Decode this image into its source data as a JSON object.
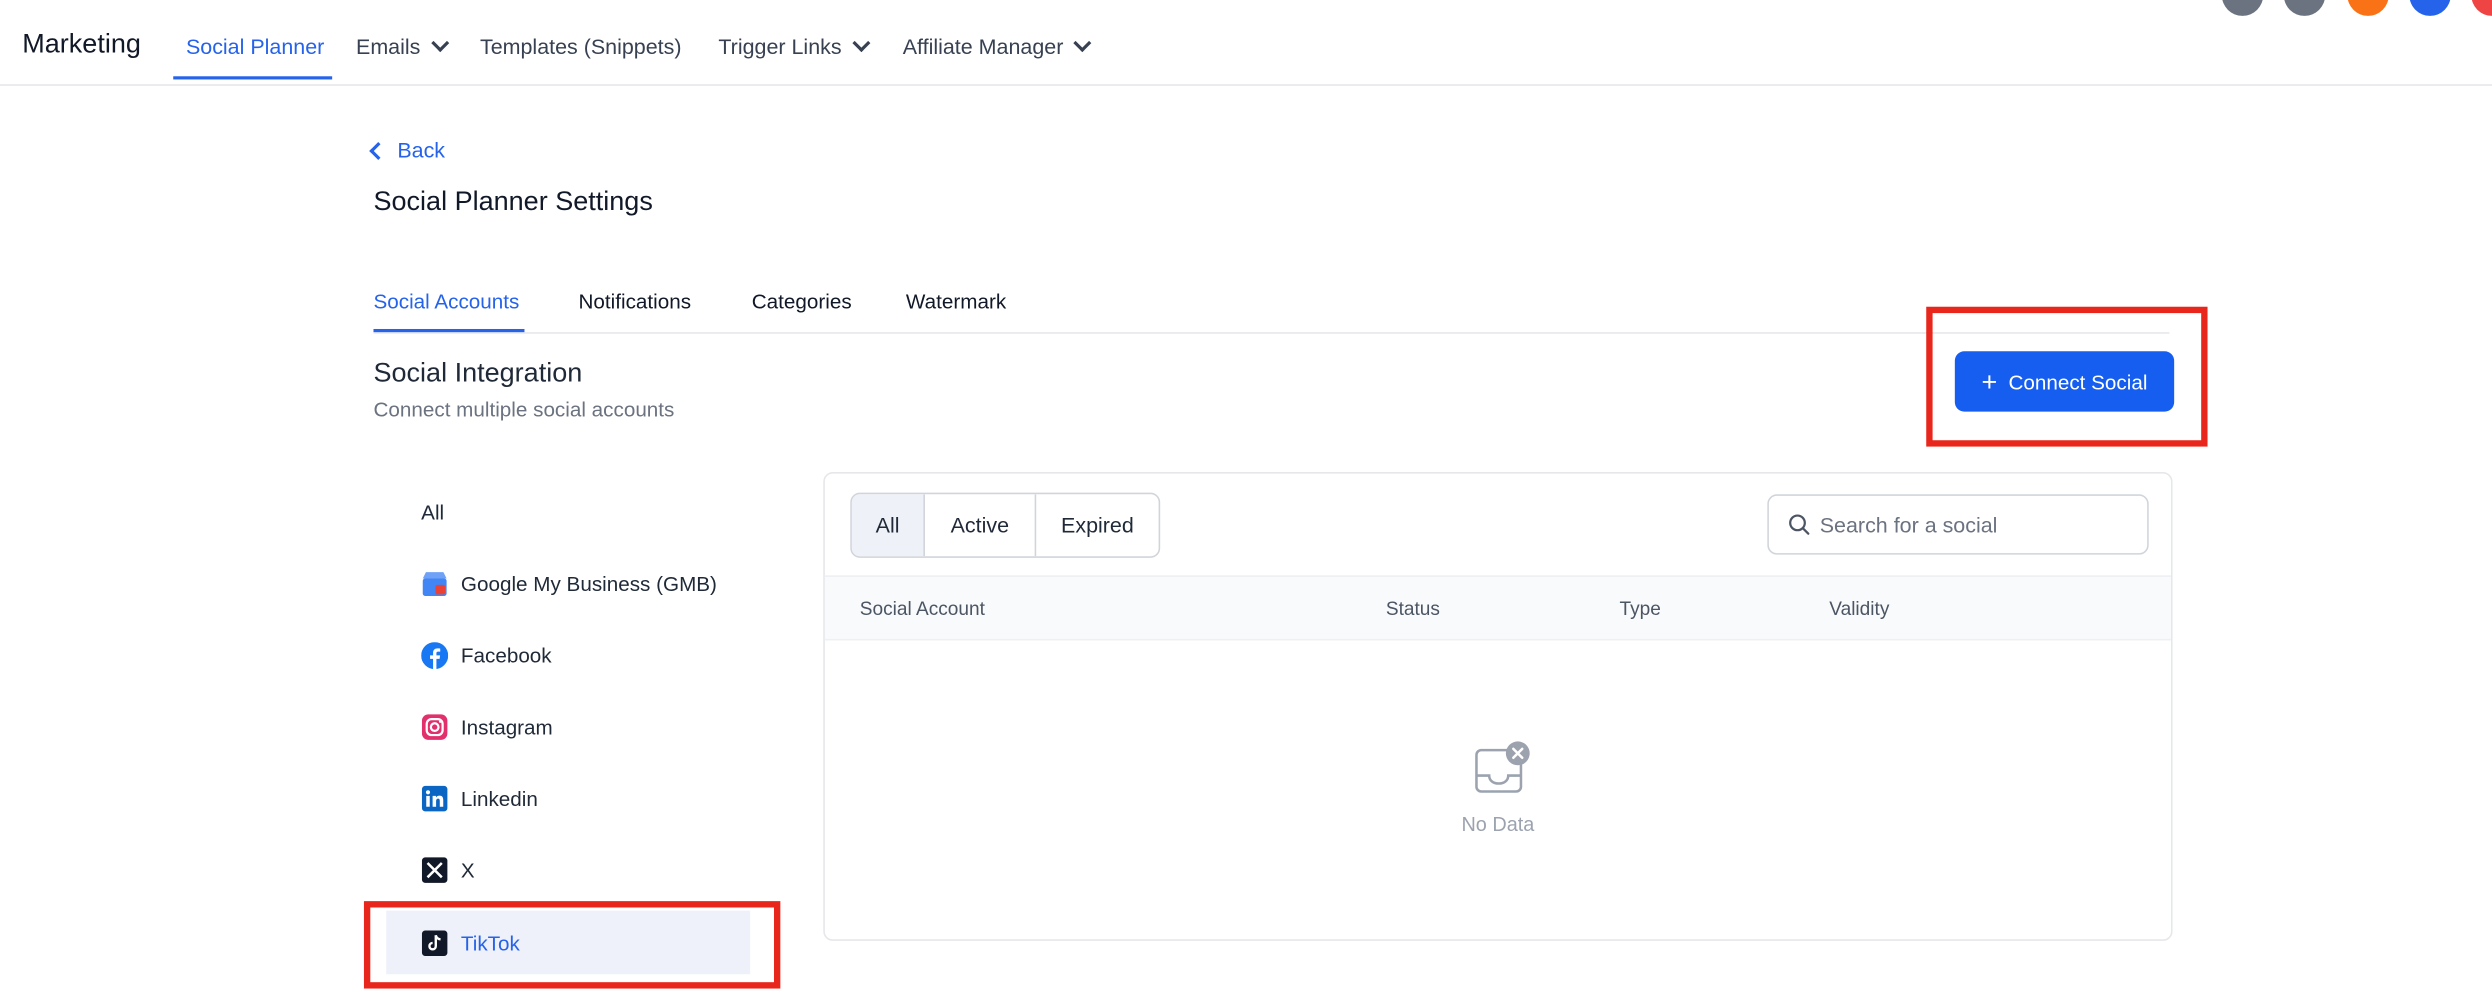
{
  "topnav": {
    "brand": "Marketing",
    "items": [
      {
        "label": "Social Planner"
      },
      {
        "label": "Emails"
      },
      {
        "label": "Templates (Snippets)"
      },
      {
        "label": "Trigger Links"
      },
      {
        "label": "Affiliate Manager"
      }
    ],
    "avatar_colors": [
      "#6b7280",
      "#6b7280",
      "#f97316",
      "#2563eb",
      "#ef4444"
    ]
  },
  "page": {
    "back_label": "Back",
    "title": "Social Planner Settings"
  },
  "tabs": [
    {
      "label": "Social Accounts"
    },
    {
      "label": "Notifications"
    },
    {
      "label": "Categories"
    },
    {
      "label": "Watermark"
    }
  ],
  "section": {
    "title": "Social Integration",
    "subtitle": "Connect multiple social accounts",
    "connect_button": "Connect Social"
  },
  "filters": [
    {
      "label": "All",
      "icon": "none"
    },
    {
      "label": "Google My Business (GMB)",
      "icon": "gmb-icon"
    },
    {
      "label": "Facebook",
      "icon": "facebook-icon"
    },
    {
      "label": "Instagram",
      "icon": "instagram-icon"
    },
    {
      "label": "Linkedin",
      "icon": "linkedin-icon"
    },
    {
      "label": "X",
      "icon": "x-icon"
    },
    {
      "label": "TikTok",
      "icon": "tiktok-icon"
    }
  ],
  "selected_filter": "TikTok",
  "table": {
    "segments": [
      {
        "label": "All"
      },
      {
        "label": "Active"
      },
      {
        "label": "Expired"
      }
    ],
    "search_placeholder": "Search for a social",
    "columns": [
      {
        "label": "Social Account"
      },
      {
        "label": "Status"
      },
      {
        "label": "Type"
      },
      {
        "label": "Validity"
      }
    ],
    "empty_text": "No Data"
  },
  "colors": {
    "accent": "#155eef",
    "highlight": "#e8261c",
    "selected_bg": "#eef1fa"
  }
}
